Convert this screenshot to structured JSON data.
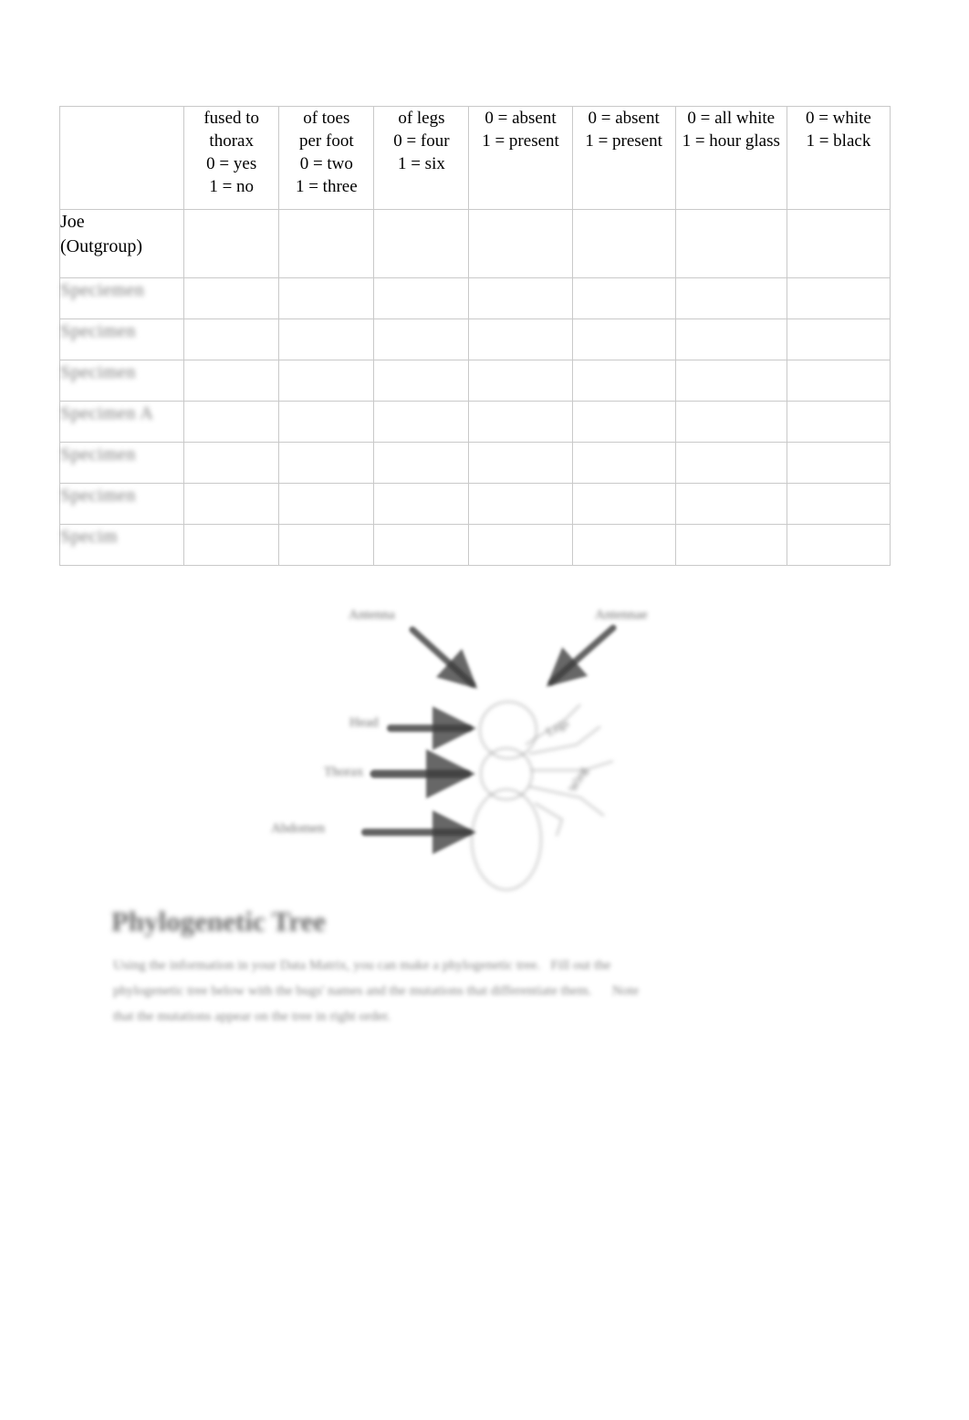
{
  "document": {
    "type": "biology-worksheet",
    "background_color": "#ffffff",
    "text_color": "#000000"
  },
  "matrix_table": {
    "corner_header": "",
    "column_headers": [
      {
        "line1": "",
        "line2": "fused to",
        "line3": "thorax",
        "line4": "0 = yes",
        "line5": "1 = no"
      },
      {
        "line1": "",
        "line2": "of toes",
        "line3": "per foot",
        "line4": "0 = two",
        "line5": "1 = three"
      },
      {
        "line1": "",
        "line2": "",
        "line3": "of legs",
        "line4": "0 = four",
        "line5": "1 = six"
      },
      {
        "line1": "",
        "line2": "",
        "line3": "",
        "line4": "0 = absent",
        "line5": "1 = present"
      },
      {
        "line1": "",
        "line2": "",
        "line3": "",
        "line4": "0 = absent",
        "line5": "1 = present"
      },
      {
        "line1": "",
        "line2": "",
        "line3": "",
        "line4": "0 = all white",
        "line5": "1 = hour glass"
      },
      {
        "line1": "",
        "line2": "",
        "line3": "",
        "line4": "0 = white",
        "line5": "1 = black"
      }
    ],
    "rows": [
      {
        "label_line1": "Joe",
        "label_line2": "(Outgroup)",
        "redacted": false,
        "cells": [
          "",
          "",
          "",
          "",
          "",
          "",
          ""
        ]
      },
      {
        "label_line1": "Speciemen",
        "label_line2": "",
        "redacted": true,
        "cells": [
          "",
          "",
          "",
          "",
          "",
          "",
          ""
        ]
      },
      {
        "label_line1": "Specimen",
        "label_line2": "",
        "redacted": true,
        "cells": [
          "",
          "",
          "",
          "",
          "",
          "",
          ""
        ]
      },
      {
        "label_line1": "Specimen",
        "label_line2": "",
        "redacted": true,
        "cells": [
          "",
          "",
          "",
          "",
          "",
          "",
          ""
        ]
      },
      {
        "label_line1": "Specimen A",
        "label_line2": "",
        "redacted": true,
        "cells": [
          "",
          "",
          "",
          "",
          "",
          "",
          ""
        ]
      },
      {
        "label_line1": "Specimen",
        "label_line2": "",
        "redacted": true,
        "cells": [
          "",
          "",
          "",
          "",
          "",
          "",
          ""
        ]
      },
      {
        "label_line1": "Specimen",
        "label_line2": "",
        "redacted": true,
        "cells": [
          "",
          "",
          "",
          "",
          "",
          "",
          ""
        ]
      },
      {
        "label_line1": "Specim",
        "label_line2": "",
        "redacted": true,
        "cells": [
          "",
          "",
          "",
          "",
          "",
          "",
          ""
        ]
      }
    ]
  },
  "anatomy_diagram": {
    "labels": {
      "antenna": "Antenna",
      "eyes": "Antennae",
      "head": "Head",
      "thorax": "Thorax",
      "abdomen": "Abdomen",
      "legs": "Legs",
      "wing": "Wing"
    }
  },
  "phylogenetic_section": {
    "heading": "Phylogenetic Tree",
    "body_line1": "Using the information in your Data Matrix, you can make a phylogenetic tree.   Fill out the",
    "body_line2": "phylogenetic tree below with the bugs' names and the mutations that differentiate them.      Note",
    "body_line3": "that the mutations appear on the tree in right order."
  }
}
